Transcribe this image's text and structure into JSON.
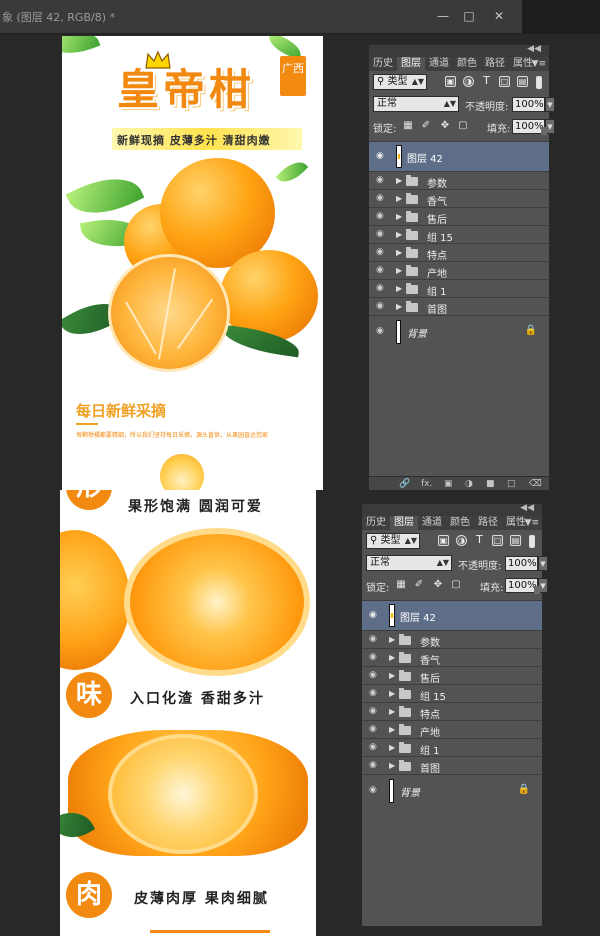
{
  "window": {
    "title": "象 (图层 42, RGB/8) *",
    "minimize_icon": "minimize-icon",
    "maximize_icon": "maximize-icon",
    "close_icon": "close-icon"
  },
  "design": {
    "product_name": "皇帝柑",
    "badge": "广西",
    "slogan": "新鲜现摘 皮薄多汁 清甜肉嫩",
    "section_heading": "每日新鲜采摘",
    "section_text": "每颗柑橘都要精细，所以我们坚持每日采摘，源头直供，从果园直达您家",
    "shape_caption": "果形饱满 圆润可爱",
    "shape_char": "形",
    "taste_char": "味",
    "taste_caption": "入口化渣 香甜多汁",
    "flesh_char": "肉",
    "flesh_caption": "皮薄肉厚 果肉细腻"
  },
  "panel": {
    "tabs": [
      "历史",
      "图层",
      "通道",
      "颜色",
      "路径",
      "属性"
    ],
    "active_tab": "图层",
    "filter_label": "类型",
    "blend_mode": "正常",
    "opacity_label": "不透明度:",
    "opacity_value": "100%",
    "lock_label": "锁定:",
    "fill_label": "填充:",
    "fill_value": "100%",
    "selected_layer": "图层 42",
    "groups": [
      "参数",
      "香气",
      "售后",
      "组 15",
      "特点",
      "产地",
      "组 1",
      "首图"
    ],
    "background_layer": "背景",
    "footer_icons": [
      "link-icon",
      "fx-icon",
      "mask-icon",
      "adjustment-icon",
      "new-group-icon",
      "new-layer-icon",
      "trash-icon"
    ],
    "footer_fx": "fx."
  },
  "colors": {
    "accent_orange": "#f28a12",
    "selected_layer": "#5e6e88",
    "panel_bg": "#535353",
    "workspace_bg": "#282828"
  }
}
